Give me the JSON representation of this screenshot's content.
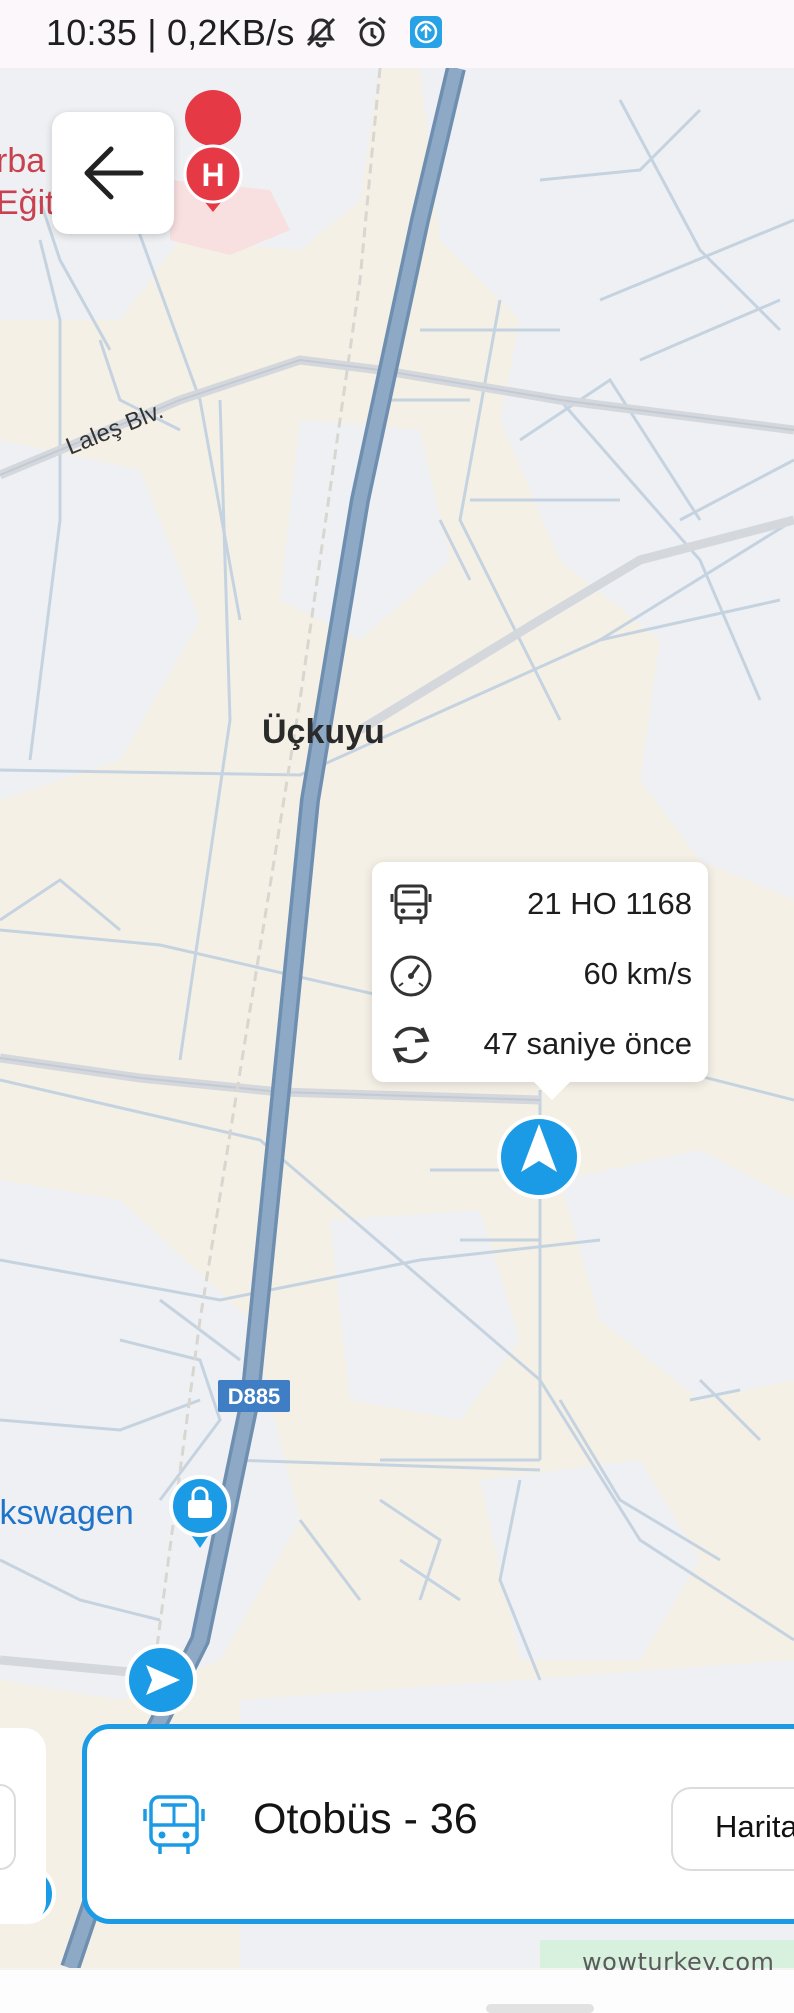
{
  "status_bar": {
    "text": "10:35 | 0,2KB/s",
    "icons": [
      "mute-bell-icon",
      "alarm-clock-icon",
      "upload-notification-icon"
    ]
  },
  "map": {
    "labels": {
      "district": "Üçkuyu",
      "street": "Laleş Blv.",
      "highway": "D885",
      "poi_brand": "lkswagen",
      "hospital_line1": "rba",
      "hospital_line2": "Eğit"
    },
    "markers": [
      "hospital-marker-icon",
      "shopping-bag-marker-icon",
      "vehicle-navigation-marker-icon",
      "direction-arrow-marker-icon"
    ],
    "colors": {
      "land": "#f4f0e6",
      "built_area": "#eef0f3",
      "road": "#c5d3e0",
      "highway": "#8aa4bf",
      "accent_blue": "#1b9be6",
      "hospital_red": "#e53946"
    }
  },
  "vehicle_info": {
    "plate": "21 HO 1168",
    "speed": "60 km/s",
    "last_update": "47 saniye önce"
  },
  "bottom_card": {
    "route_label": "Otobüs - 36",
    "map_button_label": "Harita"
  },
  "watermark": "wowturkey.com"
}
